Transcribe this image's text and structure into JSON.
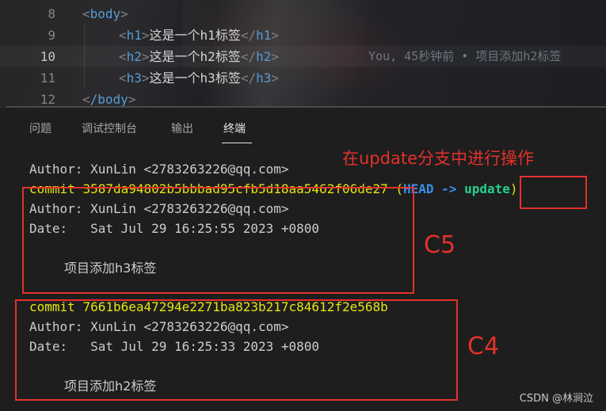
{
  "editor": {
    "lines": [
      {
        "num": "8",
        "indent": "",
        "tag": "body",
        "closing": false,
        "text": "",
        "close_tag": ""
      },
      {
        "num": "9",
        "indent": "    ",
        "tag": "h1",
        "text": "这是一个h1标签",
        "close_tag": "h1"
      },
      {
        "num": "10",
        "indent": "    ",
        "tag": "h2",
        "text": "这是一个h2标签",
        "close_tag": "h2"
      },
      {
        "num": "11",
        "indent": "    ",
        "tag": "h3",
        "text": "这是一个h3标签",
        "close_tag": "h3"
      },
      {
        "num": "12",
        "indent": "",
        "tag": "/body",
        "closing": true,
        "text": "",
        "close_tag": ""
      }
    ],
    "blame": "You, 45秒钟前 • 项目添加h2标签"
  },
  "panel": {
    "tabs": [
      "问题",
      "调试控制台",
      "输出",
      "终端"
    ],
    "active_tab": "终端"
  },
  "terminal": {
    "author_line_1": "Author: XunLin <2783263226@qq.com>",
    "commit_1_prefix": "commit ",
    "commit_1_hash": "3587da94802b5bbbad95cfb5d18aa5462f06de27",
    "commit_1_head": "HEAD ->",
    "commit_1_branch": "update",
    "author_line_2": "Author: XunLin <2783263226@qq.com>",
    "date_line_2": "Date:   Sat Jul 29 16:25:55 2023 +0800",
    "message_2": "项目添加h3标签",
    "commit_2_prefix": "commit ",
    "commit_2_hash": "7661b6ea47294e2271ba823b217c84612f2e568b",
    "author_line_3": "Author: XunLin <2783263226@qq.com>",
    "date_line_3": "Date:   Sat Jul 29 16:25:33 2023 +0800",
    "message_3": "项目添加h2标签"
  },
  "annotations": {
    "note": "在update分支中进行操作",
    "label_c5": "C5",
    "label_c4": "C4",
    "color": "#e4312b"
  },
  "watermark": "CSDN @林涧泣"
}
